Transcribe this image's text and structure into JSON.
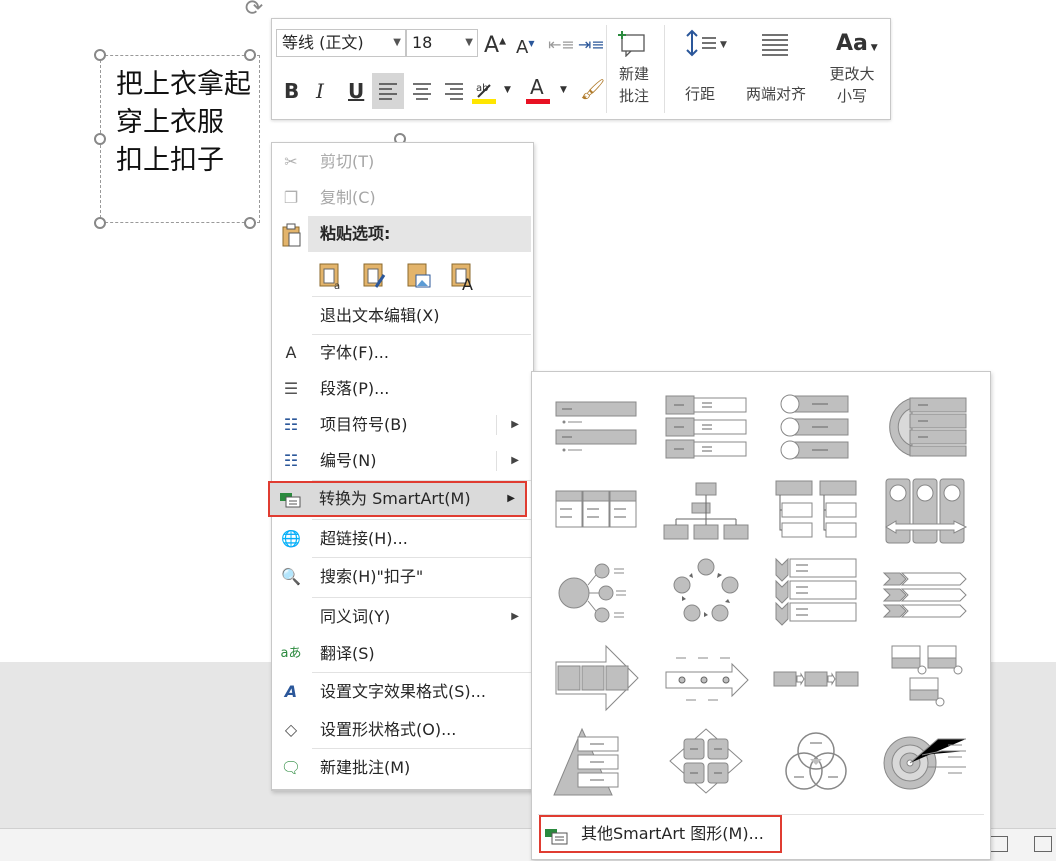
{
  "slide": {
    "lines": [
      "把上衣拿起",
      "穿上衣服",
      "扣上扣子"
    ]
  },
  "minitoolbar": {
    "font_name": "等线 (正文)",
    "font_size": "18",
    "grow_font": "A",
    "shrink_font": "A",
    "bold": "B",
    "italic": "I",
    "underline": "U",
    "font_color": "A",
    "new_comment": [
      "新建",
      "批注"
    ],
    "line_spacing": "行距",
    "justify": "两端对齐",
    "change_case_icon": "Aa",
    "change_case": [
      "更改大",
      "小写"
    ]
  },
  "context_menu": {
    "cut": "剪切(T)",
    "copy": "复制(C)",
    "paste_options": "粘贴选项:",
    "exit_edit": "退出文本编辑(X)",
    "font": "字体(F)...",
    "paragraph": "段落(P)...",
    "bullets": "项目符号(B)",
    "numbering": "编号(N)",
    "convert_smartart": "转换为 SmartArt(M)",
    "hyperlink": "超链接(H)...",
    "search": "搜索(H)\"扣子\"",
    "synonyms": "同义词(Y)",
    "translate": "翻译(S)",
    "text_effects": "设置文字效果格式(S)...",
    "shape_format": "设置形状格式(O)...",
    "new_comment": "新建批注(M)"
  },
  "gallery": {
    "more_label": "其他SmartArt 图形(M)..."
  },
  "colors": {
    "highlight_border": "#e03c31",
    "menu_icon": "#2b579a",
    "font_color_bar": "#e81123",
    "highlight_bar": "#ffe600"
  }
}
